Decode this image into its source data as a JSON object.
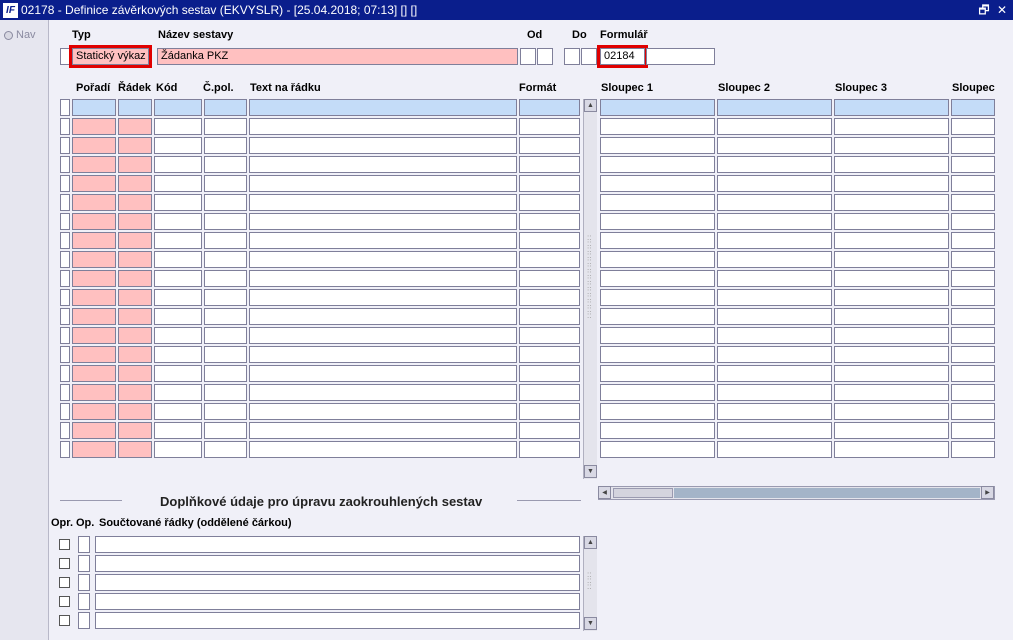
{
  "window": {
    "title": "02178 - Definice závěrkových sestav (EKVYSLR) - [25.04.2018; 07:13] [] []",
    "app_icon": "IF",
    "restore_glyph": "🗗",
    "close_glyph": "✕"
  },
  "nav": {
    "label": "Nav"
  },
  "header": {
    "labels": {
      "typ": "Typ",
      "nazev": "Název sestavy",
      "od": "Od",
      "do": "Do",
      "formular": "Formulář"
    },
    "typ_value": "Statický výkaz",
    "nazev_value": "Žádanka PKZ",
    "od_value": "",
    "do_value": "",
    "formular_value": "02184"
  },
  "grid": {
    "columns": [
      "Pořadí",
      "Řádek",
      "Kód",
      "Č.pol.",
      "Text na řádku",
      "Formát"
    ],
    "right_columns": [
      "Sloupec 1",
      "Sloupec 2",
      "Sloupec 3",
      "Sloupec"
    ]
  },
  "section": {
    "title": "Doplňkové údaje pro úpravu zaokrouhlených sestav",
    "columns": {
      "opr": "Opr.",
      "op": "Op.",
      "rows": "Součtované řádky (oddělené čárkou)"
    }
  },
  "colors": {
    "titlebar": "#0a1e8c",
    "highlight": "#e00000",
    "required": "#ffc0c0",
    "current": "#c4dcf8"
  }
}
